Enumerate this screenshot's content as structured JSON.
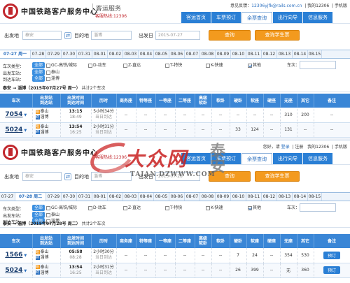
{
  "header": {
    "brand": "中国铁路客户服务中心",
    "brand_sub": "客运服务",
    "hotline": "客服热线:12306",
    "feedback_prefix": "意见反馈：",
    "feedback_email": "12306yjfk@rails.com.cn",
    "welcome": "您好，请",
    "login": "登录",
    "register": "注册",
    "mine": "我的12306",
    "mobile": "手机版"
  },
  "nav": [
    "客运首页",
    "车票预订",
    "余票查询",
    "出行向导",
    "信息服务"
  ],
  "nav_active_index": 2,
  "search": {
    "from_label": "出发地",
    "from_value": "泰安",
    "to_label": "目的地",
    "to_value": "淄博",
    "date_label": "出发日",
    "date_value": "2015-07-27",
    "query_btn": "查询",
    "student_btn": "查询学生票"
  },
  "panels": [
    {
      "dates": [
        "07-27 周一",
        "07-28",
        "07-29",
        "07-30",
        "07-31",
        "08-01",
        "08-02",
        "08-03",
        "08-04",
        "08-05",
        "08-06",
        "08-07",
        "08-08",
        "08-09",
        "08-10",
        "08-11",
        "08-12",
        "08-13",
        "08-14",
        "08-15"
      ],
      "active_date": 0,
      "summary_route": "泰安 → 淄博（2015年07月27号 周一）",
      "summary_count": "共计2个车次",
      "rows": [
        {
          "no": "7054",
          "from": "泰山",
          "to": "淄博",
          "dep": "13:15",
          "arr": "18:49",
          "dur": "5小时34分",
          "dur_sub": "当日到达",
          "seats": [
            "--",
            "--",
            "--",
            "--",
            "--",
            "--",
            "--",
            "--",
            "--",
            "310",
            "200",
            "--"
          ]
        },
        {
          "no": "5024",
          "from": "泰山",
          "to": "淄博",
          "dep": "13:54",
          "arr": "16:25",
          "dur": "2小时31分",
          "dur_sub": "当日到达",
          "seats": [
            "--",
            "--",
            "--",
            "--",
            "--",
            "--",
            "33",
            "124",
            "--",
            "131",
            "--",
            "--"
          ]
        }
      ]
    },
    {
      "dates": [
        "07-27",
        "07-28 周二",
        "07-29",
        "07-30",
        "07-31",
        "08-01",
        "08-02",
        "08-03",
        "08-04",
        "08-05",
        "08-06",
        "08-07",
        "08-08",
        "08-09",
        "08-10",
        "08-11",
        "08-12",
        "08-13",
        "08-14",
        "08-15"
      ],
      "active_date": 1,
      "summary_route": "泰安 → 淄博（2015年07月28号 周二）",
      "summary_count": "共计2个车次",
      "date_value": "2015-07-28",
      "rows": [
        {
          "no": "1566",
          "from": "泰山",
          "to": "淄博",
          "dep": "05:58",
          "arr": "08:28",
          "dur": "2小时30分",
          "dur_sub": "当日到达",
          "seats": [
            "--",
            "--",
            "--",
            "--",
            "--",
            "--",
            "7",
            "24",
            "--",
            "354",
            "530",
            "--"
          ]
        },
        {
          "no": "5024",
          "from": "泰山",
          "to": "淄博",
          "dep": "13:54",
          "arr": "16:25",
          "dur": "2小时31分",
          "dur_sub": "当日到达",
          "seats": [
            "--",
            "--",
            "--",
            "--",
            "--",
            "--",
            "26",
            "399",
            "--",
            "无",
            "360",
            "--"
          ]
        }
      ]
    }
  ],
  "filters": {
    "type_label": "车次类型：",
    "all": "全部",
    "types": [
      "GC-高铁/城际",
      "D-动车",
      "Z-直达",
      "T-特快",
      "K-快速",
      "其他"
    ],
    "types_checked": [
      false,
      false,
      false,
      false,
      false,
      true
    ],
    "from_station_label": "出发车站：",
    "from_station": "泰山",
    "to_station_label": "到达车站：",
    "to_station": "淄博",
    "train_no_label": "车次："
  },
  "table_headers": [
    "车次",
    "出发站\n到达站",
    "出发时间\n到达时间",
    "历时",
    "商务座",
    "特等座",
    "一等座",
    "二等座",
    "高级\n软卧",
    "软卧",
    "硬卧",
    "软座",
    "硬座",
    "无座",
    "其它",
    "备注"
  ],
  "book_btn": "预订",
  "watermark": {
    "brand": "大众网",
    "city": "泰安",
    "url": "TAIAN.DZWWW.COM"
  }
}
